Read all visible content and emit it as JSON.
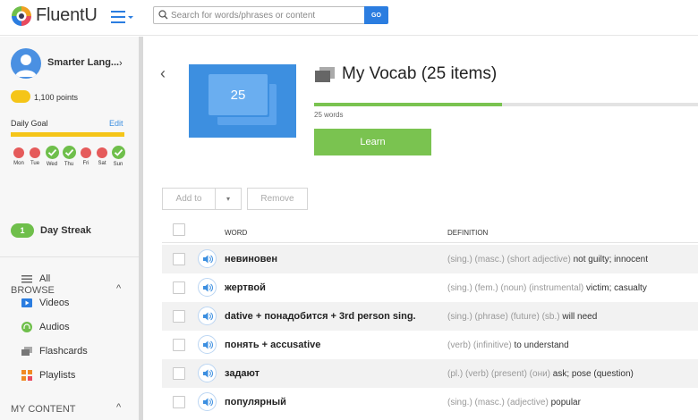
{
  "header": {
    "logo_text": "FluentU",
    "search_placeholder": "Search for words/phrases or content",
    "go_label": "GO"
  },
  "sidebar": {
    "user_name": "Smarter Lang...",
    "points": "1,100 points",
    "daily_goal_label": "Daily Goal",
    "edit_label": "Edit",
    "days": [
      {
        "label": "Mon",
        "done": false
      },
      {
        "label": "Tue",
        "done": false
      },
      {
        "label": "Wed",
        "done": true
      },
      {
        "label": "Thu",
        "done": true
      },
      {
        "label": "Fri",
        "done": false
      },
      {
        "label": "Sat",
        "done": false
      },
      {
        "label": "Sun",
        "done": true
      }
    ],
    "streak_count": "1",
    "streak_label": "Day Streak",
    "browse_heading": "BROWSE",
    "browse_items": [
      {
        "label": "All",
        "icon": "list-icon"
      },
      {
        "label": "Videos",
        "icon": "video-icon"
      },
      {
        "label": "Audios",
        "icon": "headphones-icon"
      },
      {
        "label": "Flashcards",
        "icon": "flashcards-icon"
      },
      {
        "label": "Playlists",
        "icon": "grid-icon"
      }
    ],
    "my_content_heading": "MY CONTENT"
  },
  "main": {
    "deck_number": "25",
    "title": "My Vocab (25 items)",
    "progress_fraction": 0.49,
    "words_count": "25 words",
    "learn_label": "Learn",
    "add_to_label": "Add to",
    "remove_label": "Remove",
    "columns": {
      "word": "WORD",
      "definition": "DEFINITION"
    },
    "rows": [
      {
        "word": "невиновен",
        "tags": "(sing.) (masc.) (short adjective)",
        "meaning": "not guilty; innocent"
      },
      {
        "word": "жертвой",
        "tags": "(sing.) (fem.) (noun) (instrumental)",
        "meaning": "victim; casualty"
      },
      {
        "word": "dative + понадобится + 3rd person sing.",
        "tags": "(sing.) (phrase) (future) (sb.)",
        "meaning": "will need"
      },
      {
        "word": "понять + accusative",
        "tags": "(verb) (infinitive)",
        "meaning": "to understand"
      },
      {
        "word": "задают",
        "tags": "(pl.) (verb) (present) (они)",
        "meaning": "ask; pose (question)"
      },
      {
        "word": "популярный",
        "tags": "(sing.) (masc.) (adjective)",
        "meaning": "popular"
      }
    ]
  },
  "colors": {
    "accent_blue": "#3d8fe0",
    "learn_green": "#7ac350",
    "goal_yellow": "#f5c518",
    "miss_red": "#e55b5b"
  }
}
